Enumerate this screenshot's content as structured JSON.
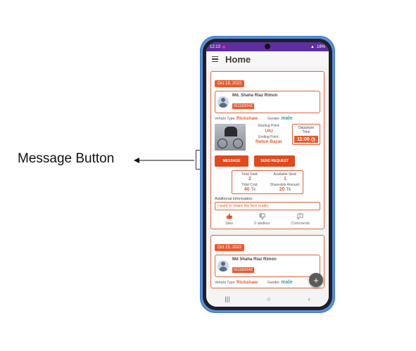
{
  "annotation": {
    "label": "Message Button"
  },
  "status_bar": {
    "time": "12:13",
    "battery": "18%"
  },
  "appbar": {
    "title": "Home"
  },
  "posts": [
    {
      "date": "Oct 18, 2022",
      "driver_name": "Md. Shaha Riaz Rimon",
      "phone": "011182048",
      "vehicle_label": "Vehicle Type:",
      "vehicle": "Rickshaw",
      "gender_label": "Gender:",
      "gender": "male",
      "starting_label": "Starting Point:",
      "starting": "UIU",
      "ending_label": "Ending Point:",
      "ending": "Natun Bazar",
      "departure_label": "Departure Time",
      "departure_time": "11:00",
      "message_button": "MESSAGE",
      "send_button": "SEND REQUEST",
      "total_seat_label": "Total Seat:",
      "total_seat": "2",
      "available_seat_label": "Available Seat:",
      "available_seat": "1",
      "total_cost_label": "Total Cost:",
      "total_cost": "40",
      "shareable_label": "Shareable Amount:",
      "shareable": "20",
      "currency": "Tk",
      "additional_label": "Additional Information:",
      "additional": "I want to share the fare eually.",
      "likes": "1like",
      "dislikes": "0 dislikes",
      "comments": "Comments"
    },
    {
      "date": "Oct 15, 2022",
      "driver_name": "Md Shaha Riaz Rimon",
      "phone": "011182048",
      "vehicle_label": "Vehicle Type:",
      "vehicle": "Rickshaw",
      "gender_label": "Gender:",
      "gender": "male"
    }
  ],
  "fab": {
    "label": "+"
  },
  "navbar": {
    "recents": "|||",
    "home": "○",
    "back": "‹"
  },
  "colors": {
    "accent": "#e85a2f",
    "status_bar": "#5f2ea0",
    "phone_frame": "#5a8fd6"
  },
  "icons": [
    "menu-icon",
    "thumbs-up-icon",
    "thumbs-down-icon",
    "comment-icon",
    "clock-icon",
    "plus-icon"
  ]
}
